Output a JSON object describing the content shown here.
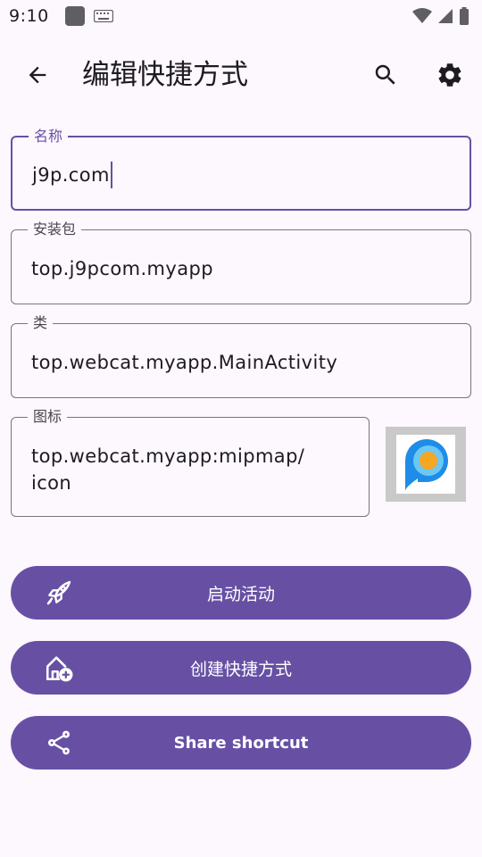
{
  "status_bar": {
    "time": "9:10",
    "icons": [
      "app-square-icon",
      "keyboard-icon",
      "wifi-icon",
      "signal-icon",
      "battery-icon"
    ]
  },
  "app_bar": {
    "title": "编辑快捷方式",
    "back_icon": "arrow-back-icon",
    "search_icon": "search-icon",
    "settings_icon": "gear-icon"
  },
  "fields": {
    "name": {
      "label": "名称",
      "value": "j9p.com",
      "focused": true
    },
    "package": {
      "label": "安装包",
      "value": "top.j9pcom.myapp"
    },
    "class": {
      "label": "类",
      "value": "top.webcat.myapp.MainActivity"
    },
    "icon": {
      "label": "图标",
      "value": "top.webcat.myapp:mipmap/\nicon"
    }
  },
  "buttons": {
    "launch": {
      "label": "启动活动",
      "icon": "rocket-icon"
    },
    "create": {
      "label": "创建快捷方式",
      "icon": "home-add-icon"
    },
    "share": {
      "label": "Share shortcut",
      "icon": "share-icon"
    }
  },
  "colors": {
    "accent": "#6750a4",
    "background": "#fdf7fe",
    "outline": "#79747e"
  }
}
